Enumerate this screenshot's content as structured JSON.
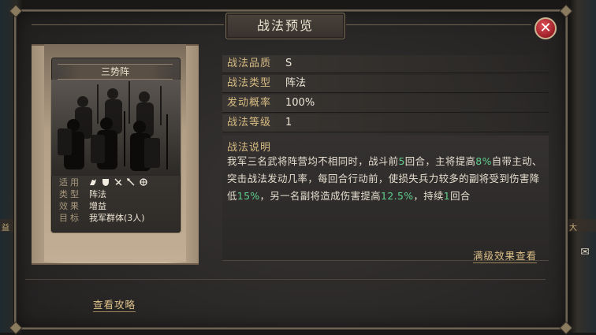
{
  "dialog": {
    "title": "战法预览",
    "close_icon": "close-icon"
  },
  "card": {
    "name": "三势阵",
    "props": [
      {
        "key": "适用",
        "value": ""
      },
      {
        "key": "类型",
        "value": "阵法"
      },
      {
        "key": "效果",
        "value": "增益"
      },
      {
        "key": "目标",
        "value": "我军群体(3人)"
      }
    ],
    "unit_icons": [
      "cavalry-icon",
      "shield-icon",
      "archer-icon",
      "spear-icon",
      "siege-icon"
    ]
  },
  "info": [
    {
      "key": "战法品质",
      "value": "S"
    },
    {
      "key": "战法类型",
      "value": "阵法"
    },
    {
      "key": "发动概率",
      "value": "100%"
    },
    {
      "key": "战法等级",
      "value": "1"
    }
  ],
  "description": {
    "title": "战法说明",
    "segments": [
      {
        "text": "我军三名武将阵营均不相同时，战斗前",
        "hl": false
      },
      {
        "text": "5",
        "hl": true
      },
      {
        "text": "回合，主将提高",
        "hl": false
      },
      {
        "text": "8%",
        "hl": true
      },
      {
        "text": "自带主动、突击战法发动几率，每回合行动前，使损失兵力较多的副将受到伤害降低",
        "hl": false
      },
      {
        "text": "15%",
        "hl": true
      },
      {
        "text": "，另一名副将造成伤害提高",
        "hl": false
      },
      {
        "text": "12.5%",
        "hl": true
      },
      {
        "text": "，持续",
        "hl": false
      },
      {
        "text": "1",
        "hl": true
      },
      {
        "text": "回合",
        "hl": false
      }
    ],
    "highlight_color": "#5fcf8e"
  },
  "links": {
    "max_level": "满级效果查看",
    "guide": "查看攻略"
  },
  "background": {
    "left_text": "益",
    "right_text": "大"
  }
}
